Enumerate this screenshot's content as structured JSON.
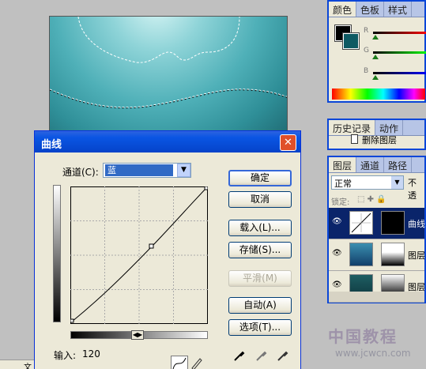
{
  "color_panel": {
    "tabs": [
      "颜色",
      "色板",
      "样式"
    ],
    "channels": [
      "R",
      "G",
      "B"
    ]
  },
  "history_panel": {
    "tabs": [
      "历史记录",
      "动作"
    ],
    "item": "删除图层"
  },
  "layers_panel": {
    "tabs": [
      "图层",
      "通道",
      "路径"
    ],
    "blend_mode": "正常",
    "opacity_label": "不透",
    "lock_label": "锁定:",
    "layers": [
      {
        "name": "曲线",
        "selected": true
      },
      {
        "name": "图层"
      },
      {
        "name": "图层"
      }
    ]
  },
  "dialog": {
    "title": "曲线",
    "channel_label": "通道(C):",
    "channel_value": "蓝",
    "buttons": {
      "ok": "确定",
      "cancel": "取消",
      "load": "载入(L)...",
      "save": "存储(S)...",
      "smooth": "平滑(M)",
      "auto": "自动(A)",
      "options": "选项(T)..."
    },
    "input_label": "输入:",
    "input_value": "120"
  },
  "watermark": {
    "text": "中国教程",
    "url": "www.jcwcn.com"
  },
  "statusbar": {
    "fragment": "文"
  },
  "colors": {
    "title_bar": "#0a55e3",
    "selected_layer": "#0a246a",
    "background_swatch": "#0e5a63"
  }
}
